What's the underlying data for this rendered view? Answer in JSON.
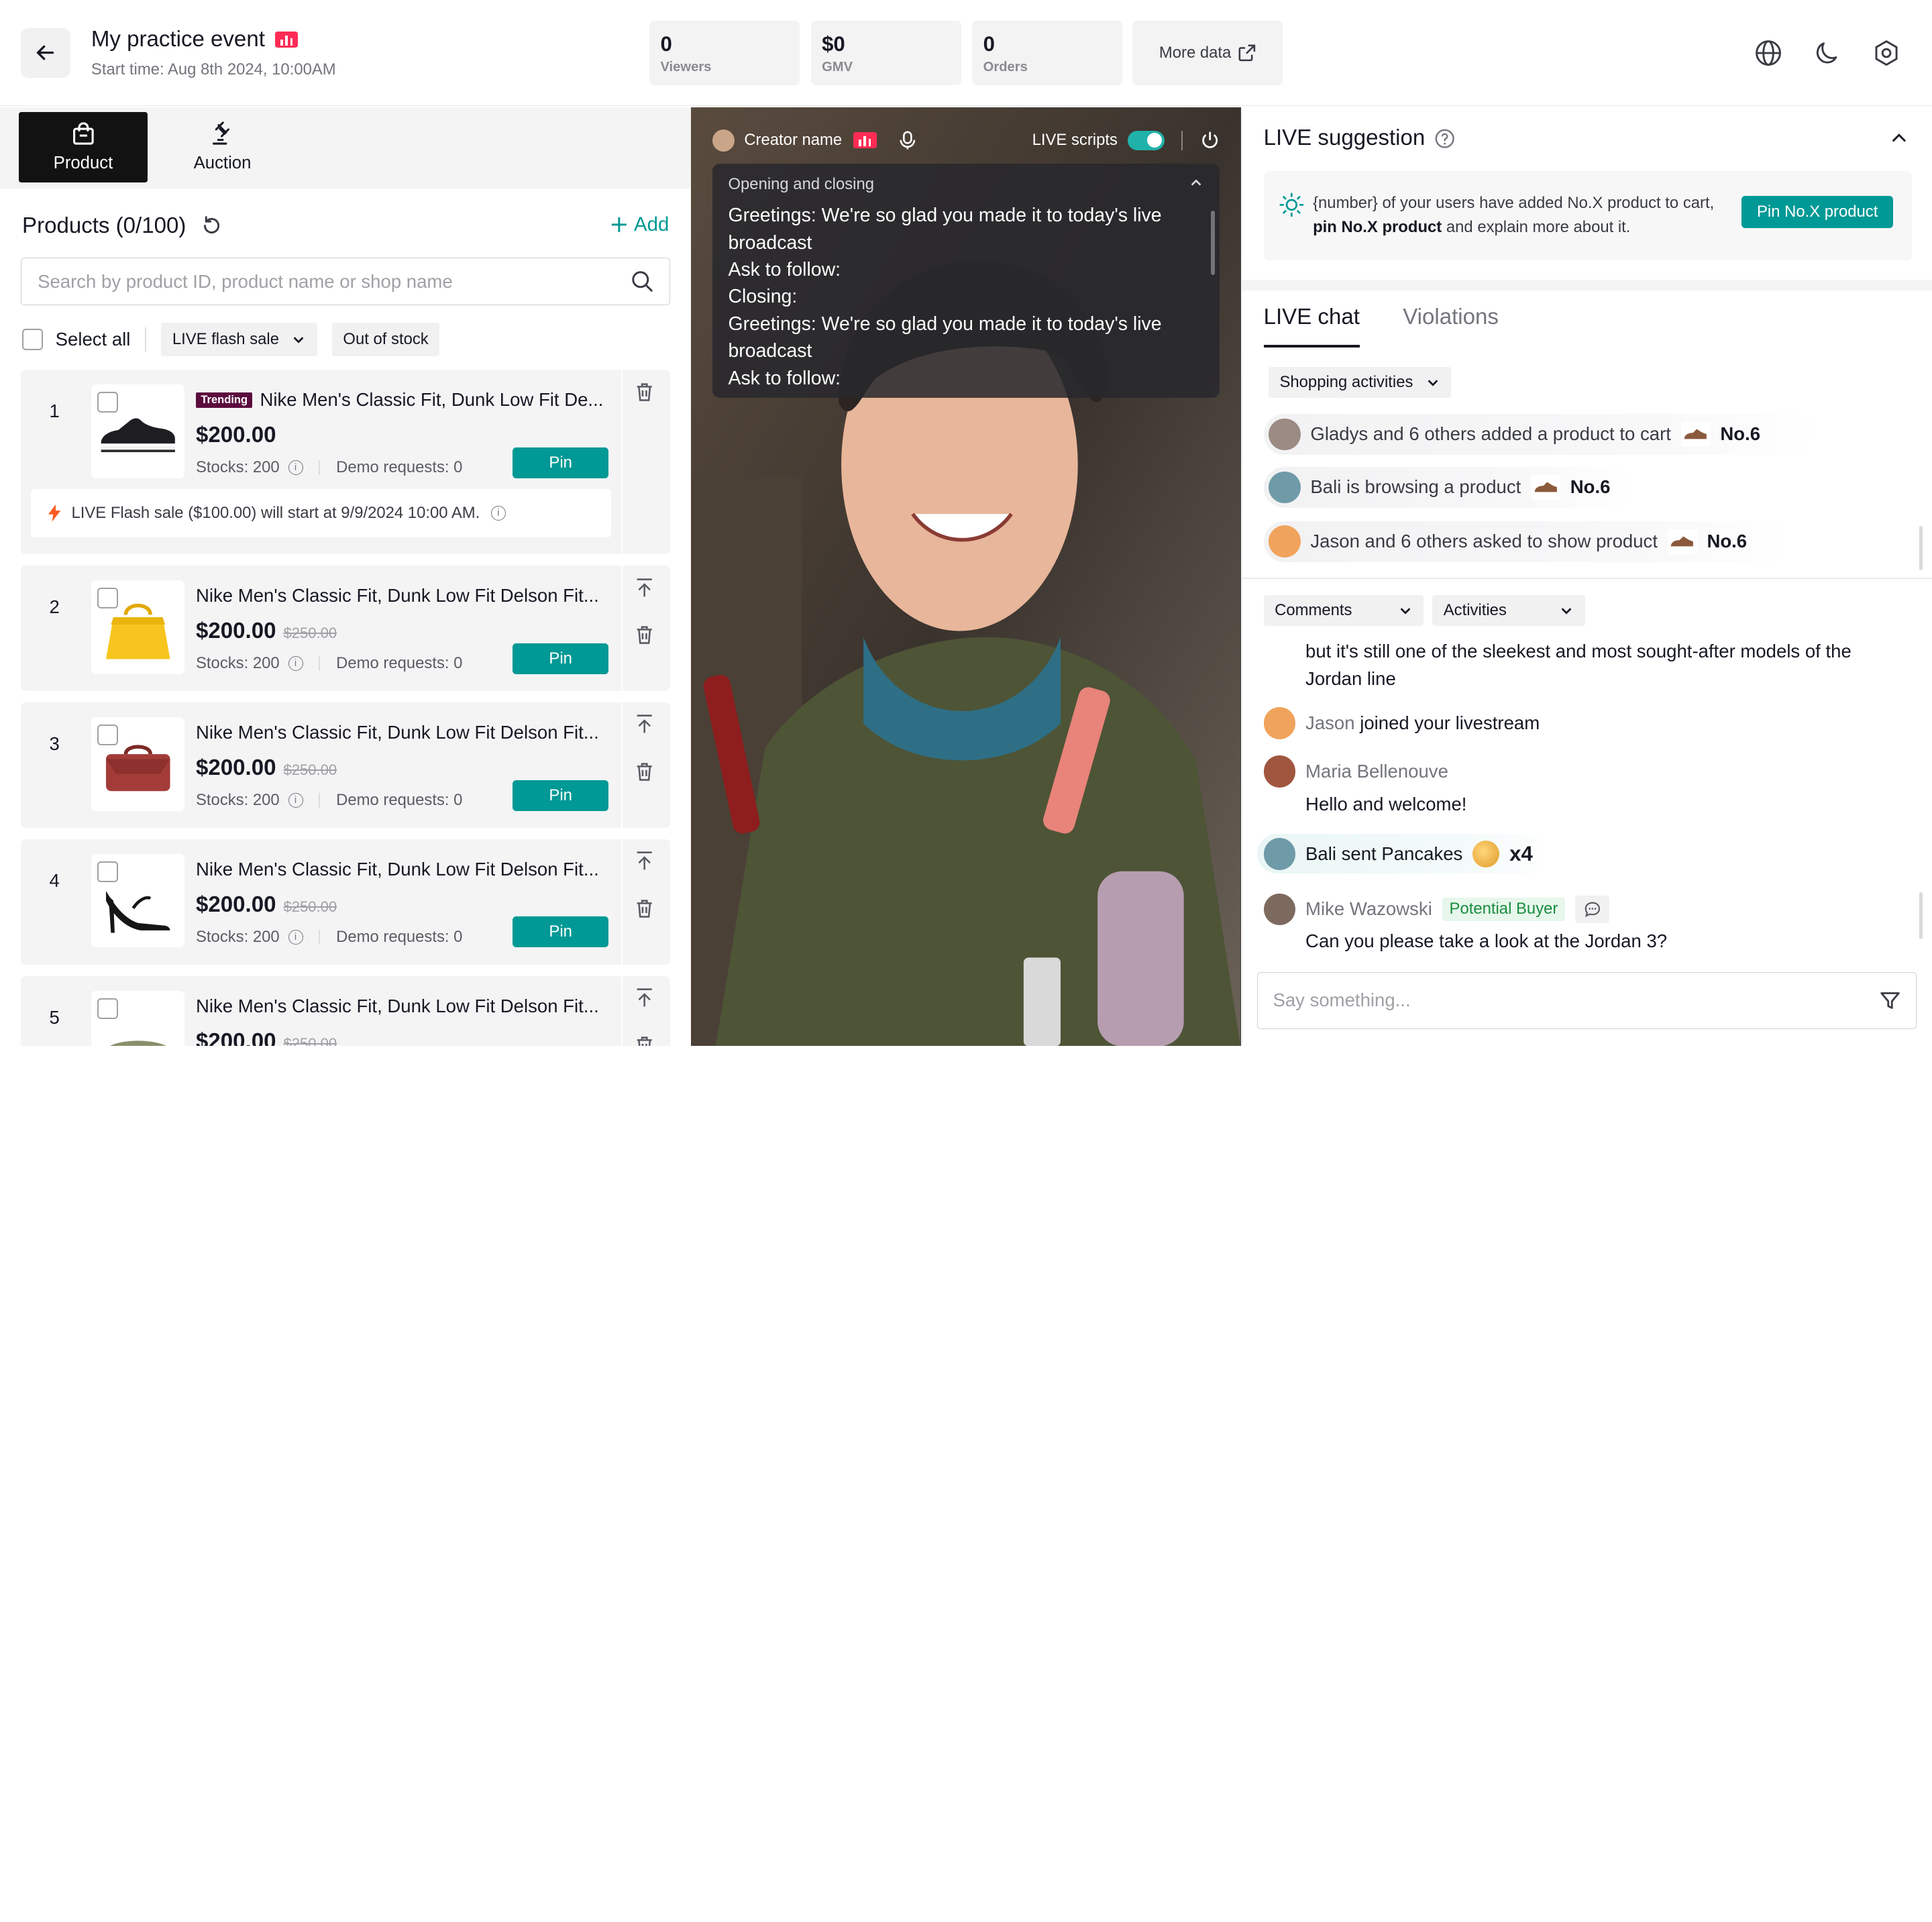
{
  "header": {
    "title": "My practice event",
    "start_time": "Start time: Aug 8th 2024, 10:00AM",
    "stats": [
      {
        "value": "0",
        "label": "Viewers"
      },
      {
        "value": "$0",
        "label": "GMV"
      },
      {
        "value": "0",
        "label": "Orders"
      }
    ],
    "more_data": "More data"
  },
  "left_tabs": [
    {
      "label": "Product",
      "icon": "bag-icon",
      "active": true
    },
    {
      "label": "Auction",
      "icon": "gavel-icon",
      "active": false
    }
  ],
  "products": {
    "title": "Products (0/100)",
    "add_label": "Add",
    "search_placeholder": "Search by product ID, product name or shop name",
    "select_all": "Select all",
    "filter_flash": "LIVE flash sale",
    "filter_stock": "Out of stock",
    "items": [
      {
        "num": "1",
        "badge": "Trending",
        "name": "Nike Men's Classic Fit, Dunk Low Fit De...",
        "price": "$200.00",
        "orig": "",
        "stock": "Stocks: 200",
        "demo": "Demo requests: 0",
        "pin": "Pin",
        "flash": "LIVE Flash sale ($100.00) will start at 9/9/2024 10:00 AM."
      },
      {
        "num": "2",
        "badge": "",
        "name": "Nike Men's Classic Fit, Dunk Low Fit Delson Fit...",
        "price": "$200.00",
        "orig": "$250.00",
        "stock": "Stocks: 200",
        "demo": "Demo requests: 0",
        "pin": "Pin"
      },
      {
        "num": "3",
        "badge": "",
        "name": "Nike Men's Classic Fit, Dunk Low Fit Delson Fit...",
        "price": "$200.00",
        "orig": "$250.00",
        "stock": "Stocks: 200",
        "demo": "Demo requests: 0",
        "pin": "Pin"
      },
      {
        "num": "4",
        "badge": "",
        "name": "Nike Men's Classic Fit, Dunk Low Fit Delson Fit...",
        "price": "$200.00",
        "orig": "$250.00",
        "stock": "Stocks: 200",
        "demo": "Demo requests: 0",
        "pin": "Pin"
      },
      {
        "num": "5",
        "badge": "",
        "name": "Nike Men's Classic Fit, Dunk Low Fit Delson Fit...",
        "price": "$200.00",
        "orig": "$250.00"
      }
    ]
  },
  "video": {
    "creator": "Creator name",
    "scripts_label": "LIVE scripts",
    "script_section": "Opening and closing",
    "script_lines": [
      "Greetings: We're so glad you made it to today's live broadcast",
      "Ask to follow:",
      "Closing:",
      "Greetings: We're so glad you made it to today's live broadcast",
      "Ask to follow:"
    ]
  },
  "suggestion": {
    "title": "LIVE suggestion",
    "text_pre": "{number} of your users have added No.X product to cart, ",
    "text_bold": "pin No.X product",
    "text_post": " and explain more about it.",
    "button": "Pin No.X product"
  },
  "chat": {
    "tabs": [
      "LIVE chat",
      "Violations"
    ],
    "filter": "Shopping activities",
    "activities": [
      {
        "text": "Gladys and 6 others added a product to cart",
        "product": "No.6"
      },
      {
        "text": "Bali is browsing a product",
        "product": "No.6"
      },
      {
        "text": "Jason and 6 others asked to show product",
        "product": "No.6"
      }
    ],
    "dd_comments": "Comments",
    "dd_activities": "Activities",
    "prev_msg": "but it's still one of the sleekest and most sought-after models of the Jordan line",
    "joined_name": "Jason",
    "joined_text": " joined your livestream",
    "maria_name": "Maria Bellenouve",
    "maria_msg": "Hello and welcome!",
    "gift_text": "Bali sent Pancakes",
    "gift_count": "x4",
    "mike_name": "Mike Wazowski",
    "mike_badge": "Potential Buyer",
    "mike_msg": "Can you please take a look at the Jordan 3?",
    "input_placeholder": "Say something..."
  },
  "colors": {
    "accent": "#009995",
    "live": "#fe2c55",
    "trending": "#5b0c3e"
  }
}
